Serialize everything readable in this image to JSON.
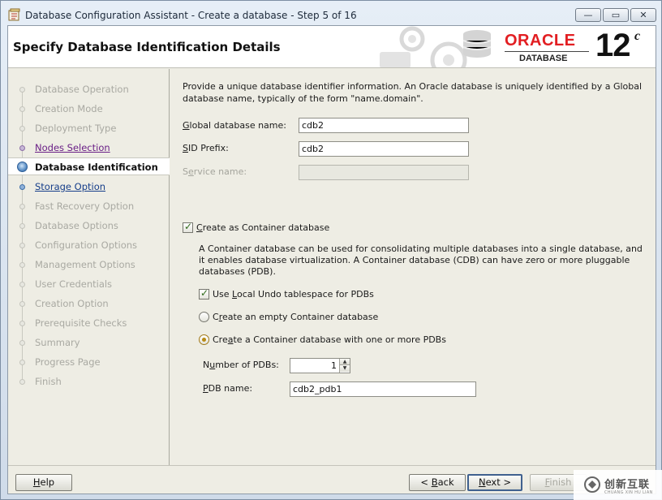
{
  "window": {
    "title": "Database Configuration Assistant - Create a database - Step 5 of 16",
    "minimize_glyph": "—",
    "maximize_glyph": "▭",
    "close_glyph": "✕"
  },
  "header": {
    "title": "Specify Database Identification Details",
    "oracle_word": "ORACLE",
    "oracle_database": "DATABASE",
    "version": "12",
    "version_suffix": "c"
  },
  "nav": {
    "items": [
      {
        "label": "Database Operation",
        "state": "disabled"
      },
      {
        "label": "Creation Mode",
        "state": "disabled"
      },
      {
        "label": "Deployment Type",
        "state": "disabled"
      },
      {
        "label": "Nodes Selection",
        "state": "visited"
      },
      {
        "label": "Database Identification",
        "state": "current"
      },
      {
        "label": "Storage Option",
        "state": "link"
      },
      {
        "label": "Fast Recovery Option",
        "state": "disabled"
      },
      {
        "label": "Database Options",
        "state": "disabled"
      },
      {
        "label": "Configuration Options",
        "state": "disabled"
      },
      {
        "label": "Management Options",
        "state": "disabled"
      },
      {
        "label": "User Credentials",
        "state": "disabled"
      },
      {
        "label": "Creation Option",
        "state": "disabled"
      },
      {
        "label": "Prerequisite Checks",
        "state": "disabled"
      },
      {
        "label": "Summary",
        "state": "disabled"
      },
      {
        "label": "Progress Page",
        "state": "disabled"
      },
      {
        "label": "Finish",
        "state": "disabled"
      }
    ]
  },
  "main": {
    "description": "Provide a unique database identifier information. An Oracle database is uniquely identified by a Global database name, typically of the form \"name.domain\".",
    "global_db_name": {
      "label_ul": "G",
      "label_rest": "lobal database name:",
      "value": "cdb2"
    },
    "sid_prefix": {
      "label_ul": "S",
      "label_rest": "ID Prefix:",
      "value": "cdb2"
    },
    "service_name": {
      "label_pre": "S",
      "label_ul": "e",
      "label_rest": "rvice name:",
      "value": ""
    },
    "container_checkbox": {
      "label_ul": "C",
      "label_rest": "reate as Container database",
      "checked": true
    },
    "container_description": "A Container database can be used for consolidating multiple databases into a single database, and it enables database virtualization. A Container database (CDB) can have zero or more pluggable databases (PDB).",
    "local_undo": {
      "label_pre": "Use ",
      "label_ul": "L",
      "label_rest": "ocal Undo tablespace for PDBs",
      "checked": true
    },
    "radio_empty": {
      "label_pre": "C",
      "label_ul": "r",
      "label_rest": "eate an empty Container database",
      "checked": false
    },
    "radio_with_pdbs": {
      "label_pre": "Cre",
      "label_ul": "a",
      "label_rest": "te a Container database with one or more PDBs",
      "checked": true
    },
    "num_pdbs": {
      "label_pre": "N",
      "label_ul": "u",
      "label_rest": "mber of PDBs:",
      "value": "1"
    },
    "pdb_name": {
      "label_ul": "P",
      "label_rest": "DB name:",
      "value": "cdb2_pdb1"
    }
  },
  "buttons": {
    "help": {
      "label_ul": "H",
      "label_rest": "elp"
    },
    "back": {
      "label_pre": "< ",
      "label_ul": "B",
      "label_rest": "ack"
    },
    "next": {
      "label_ul": "N",
      "label_rest": "ext >"
    },
    "finish": {
      "label_ul": "F",
      "label_rest": "inish"
    }
  },
  "watermark": {
    "text": "创新互联",
    "sub": "CHUANG XIN HU LIAN"
  },
  "colors": {
    "oracle_red": "#e21e22",
    "visited_link": "#6a1f86",
    "active_link": "#163e8a",
    "panel_bg": "#eeede4"
  }
}
